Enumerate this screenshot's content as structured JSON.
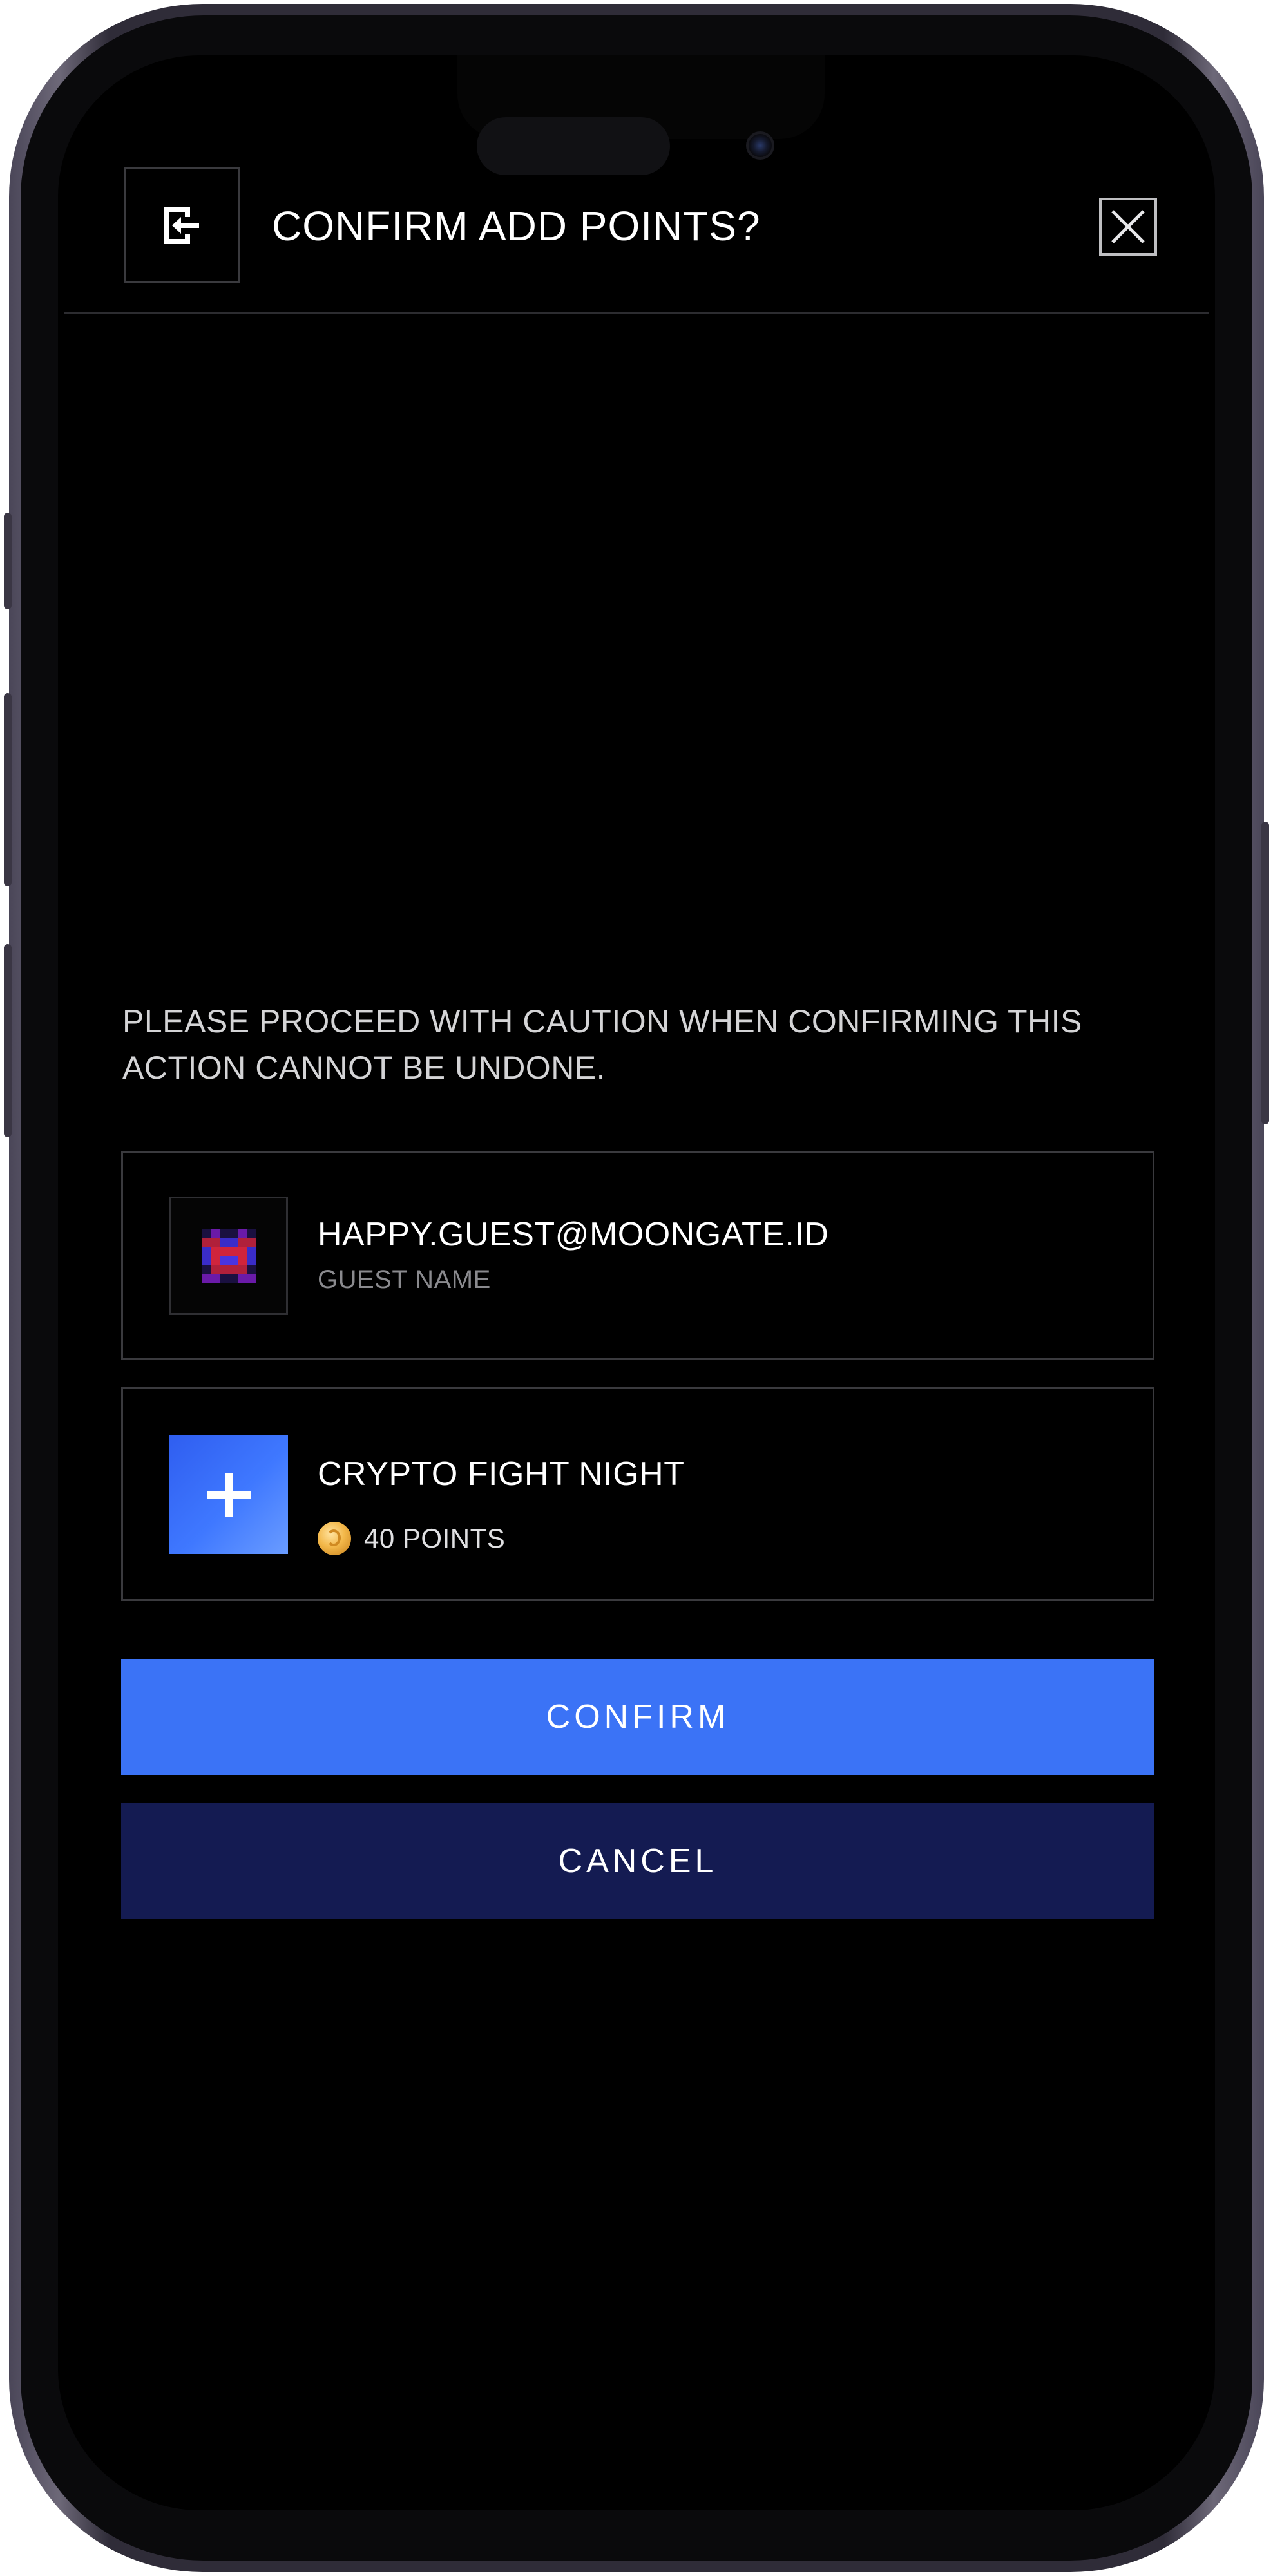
{
  "header": {
    "title": "CONFIRM ADD POINTS?"
  },
  "notice": {
    "text": "PLEASE PROCEED WITH CAUTION WHEN CONFIRMING THIS ACTION CANNOT BE UNDONE."
  },
  "guest": {
    "email": "HAPPY.GUEST@MOONGATE.ID",
    "label": "GUEST NAME"
  },
  "event": {
    "name": "CRYPTO FIGHT NIGHT",
    "points": "40 POINTS"
  },
  "actions": {
    "confirm_label": "CONFIRM",
    "cancel_label": "CANCEL"
  },
  "colors": {
    "background": "#000000",
    "primary": "#3b73f6",
    "secondary": "#141b52",
    "border": "#3a3a3e"
  }
}
